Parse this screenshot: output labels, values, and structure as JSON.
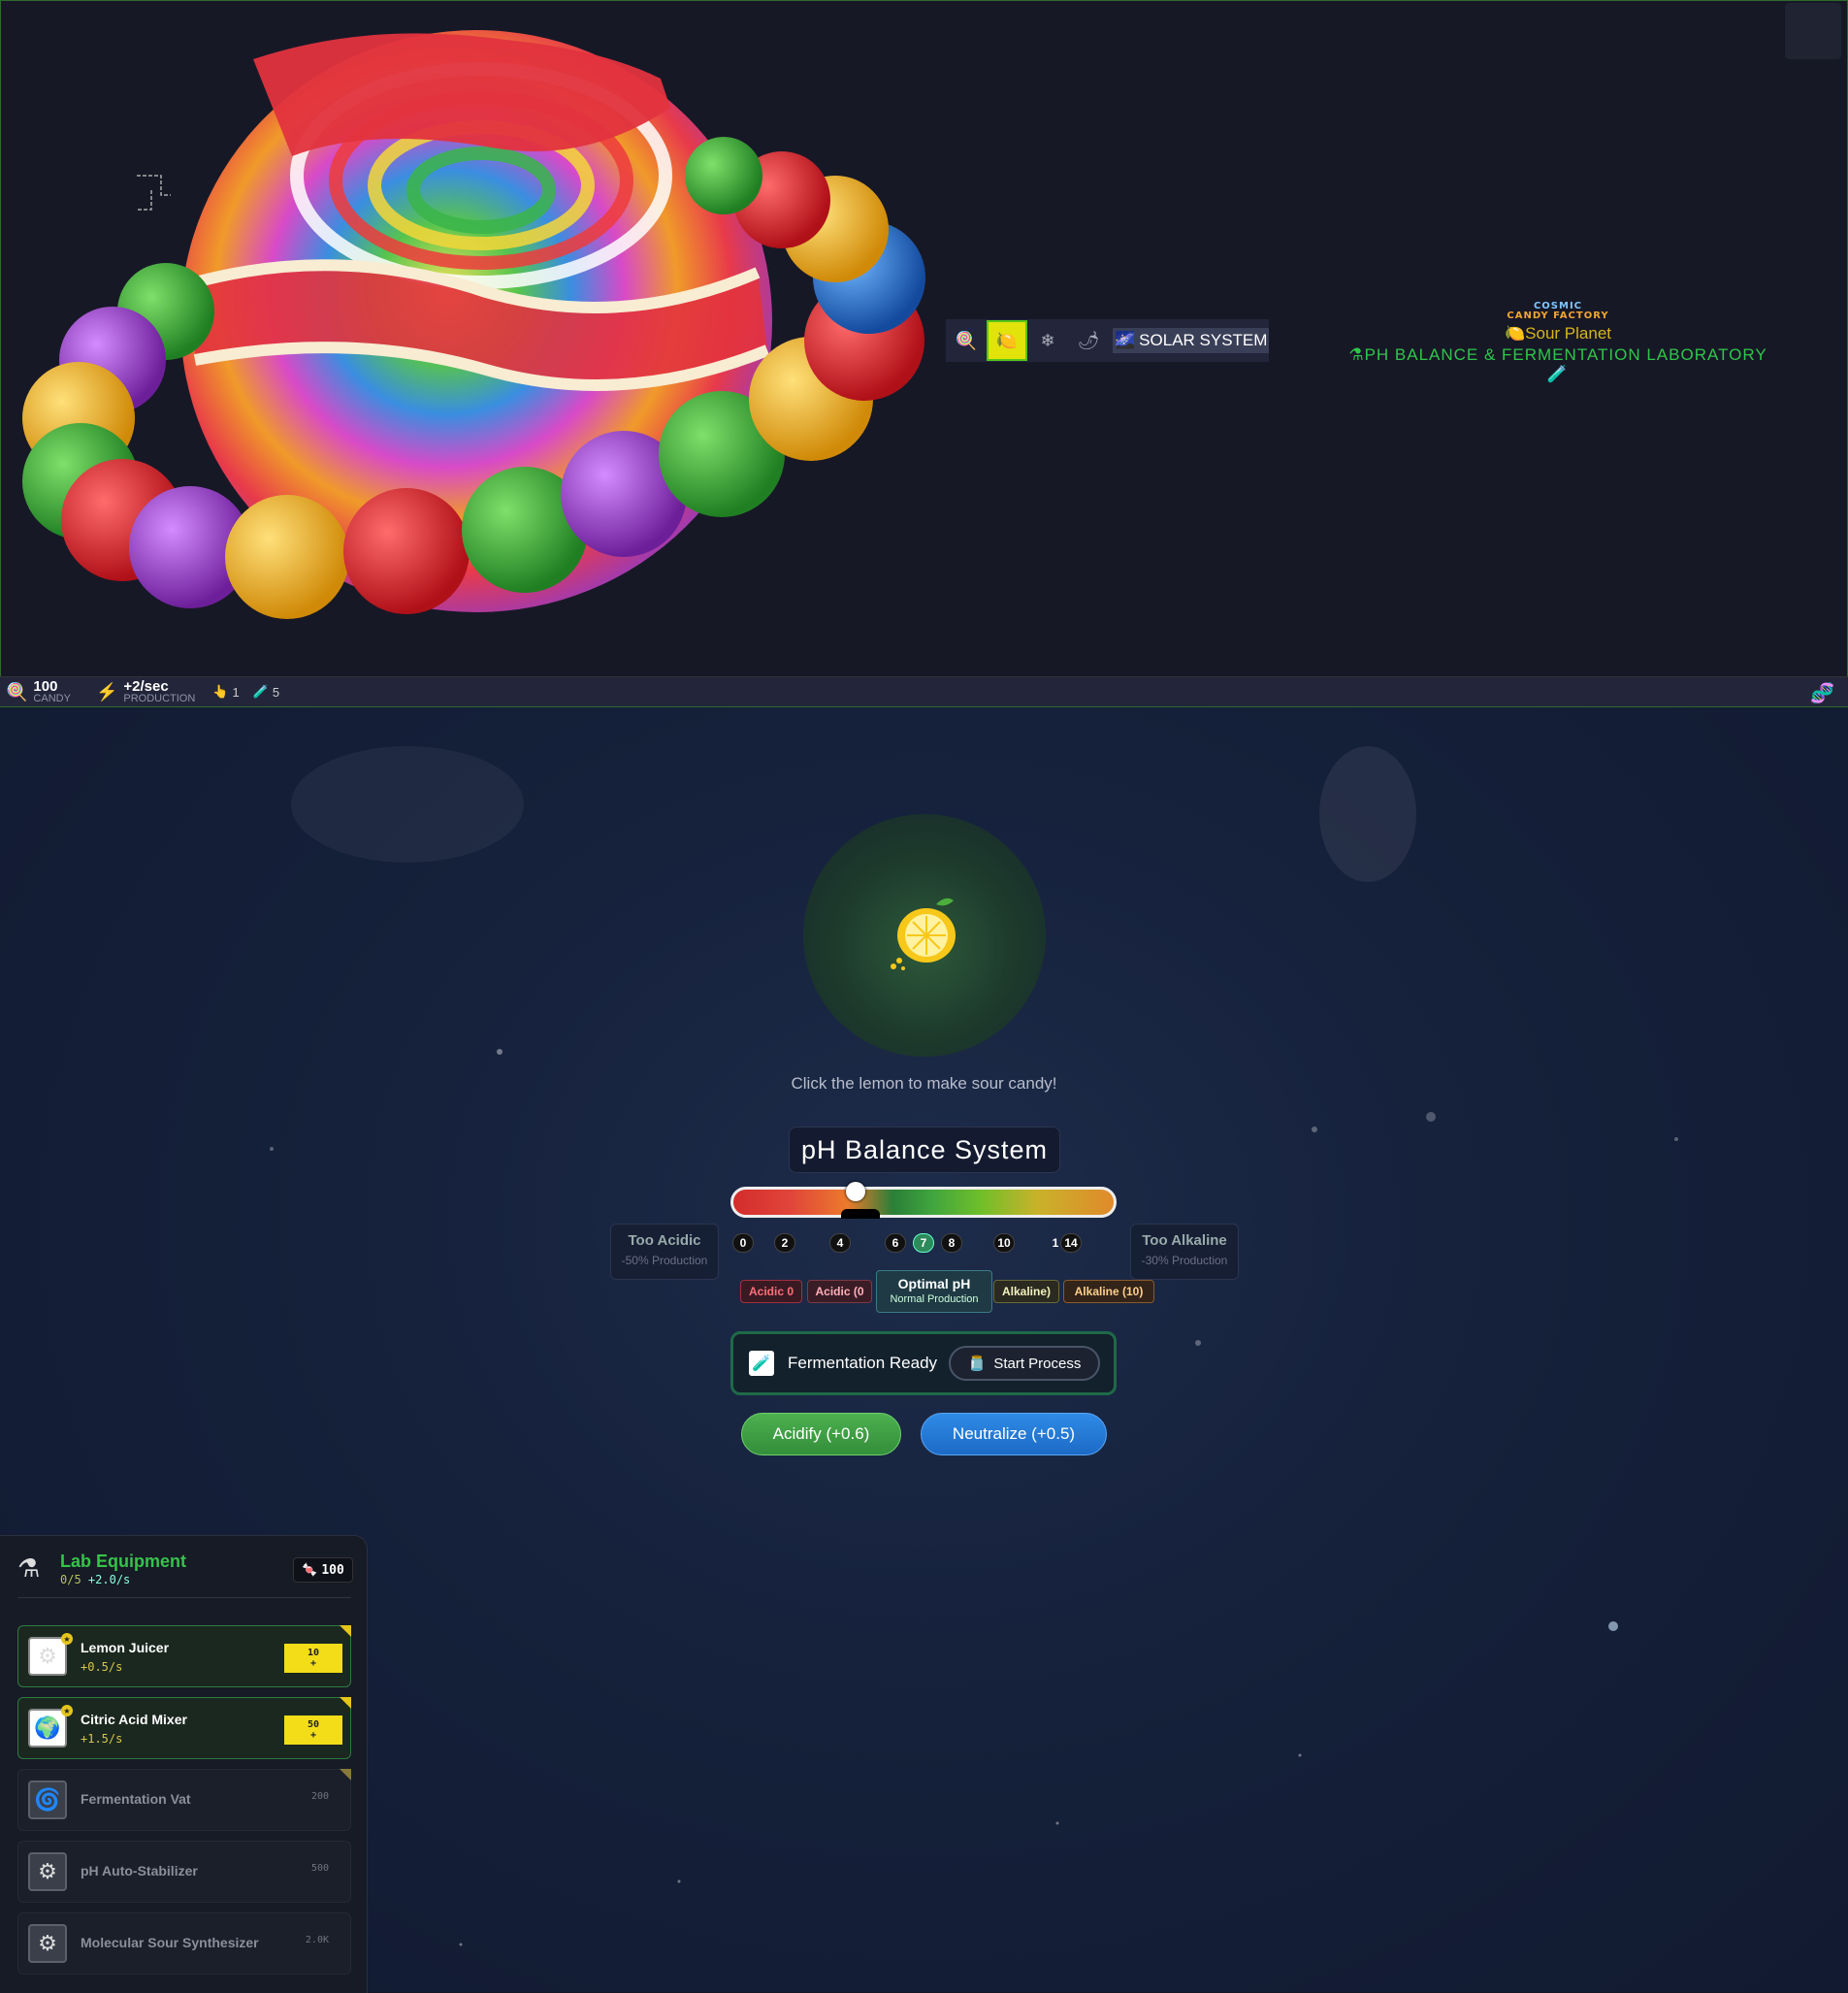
{
  "header": {
    "logo_line1": "COSMIC",
    "logo_line2": "CANDY FACTORY",
    "planet_name": "Sour Planet",
    "lab_title": "PH BALANCE & FERMENTATION LABORATORY"
  },
  "planet_nav": {
    "items": [
      {
        "icon": "candy-icon",
        "glyph": "🍭"
      },
      {
        "icon": "lemon-icon",
        "glyph": "🍋"
      },
      {
        "icon": "snowflake-icon",
        "glyph": "❄"
      },
      {
        "icon": "chili-icon",
        "glyph": "🌶"
      }
    ],
    "solar_label": "SOLAR SYSTEM"
  },
  "status": {
    "candy_value": "100",
    "candy_label": "CANDY",
    "production_value": "+2/sec",
    "production_label": "PRODUCTION",
    "clicks": "1",
    "tests": "5"
  },
  "lemon_area": {
    "hint": "Click the lemon to make sour candy!"
  },
  "ph": {
    "title": "pH Balance System",
    "current_value": 7,
    "scale_min": 0,
    "scale_max": 14,
    "ticks": [
      "0",
      "2",
      "4",
      "6",
      "7",
      "8",
      "10",
      "1",
      "14"
    ],
    "active_tick": "7",
    "too_acidic": {
      "title": "Too Acidic",
      "sub": "-50% Production"
    },
    "too_alkaline": {
      "title": "Too Alkaline",
      "sub": "-30% Production"
    },
    "zones": {
      "acidic0": "Acidic 0",
      "acidic": "Acidic (0",
      "optimal_title": "Optimal pH",
      "optimal_sub": "Normal Production",
      "alkaline": "Alkaline)",
      "alkaline10": "Alkaline (10)"
    }
  },
  "fermentation": {
    "status": "Fermentation Ready",
    "start_label": "Start Process"
  },
  "actions": {
    "acidify": "Acidify (+0.6)",
    "neutralize": "Neutralize (+0.5)"
  },
  "lab": {
    "title": "Lab Equipment",
    "owned": "0/5",
    "rate": "+2.0/s",
    "candy": "100",
    "items": [
      {
        "name": "Lemon Juicer",
        "rate": "+0.5/s",
        "cost": "10",
        "affordable": true,
        "icon": "gear-icon"
      },
      {
        "name": "Citric Acid Mixer",
        "rate": "+1.5/s",
        "cost": "50",
        "affordable": true,
        "icon": "globe-icon"
      },
      {
        "name": "Fermentation Vat",
        "rate": "",
        "cost": "200",
        "affordable": false,
        "icon": "vortex-icon"
      },
      {
        "name": "pH Auto-Stabilizer",
        "rate": "",
        "cost": "500",
        "affordable": false,
        "icon": "gear-icon"
      },
      {
        "name": "Molecular Sour Synthesizer",
        "rate": "",
        "cost": "2.0K",
        "affordable": false,
        "icon": "gear-icon"
      }
    ]
  },
  "colors": {
    "accent_green": "#37c24a",
    "buy_yellow": "#f2dd18",
    "planet_gold": "#d7b41d"
  }
}
